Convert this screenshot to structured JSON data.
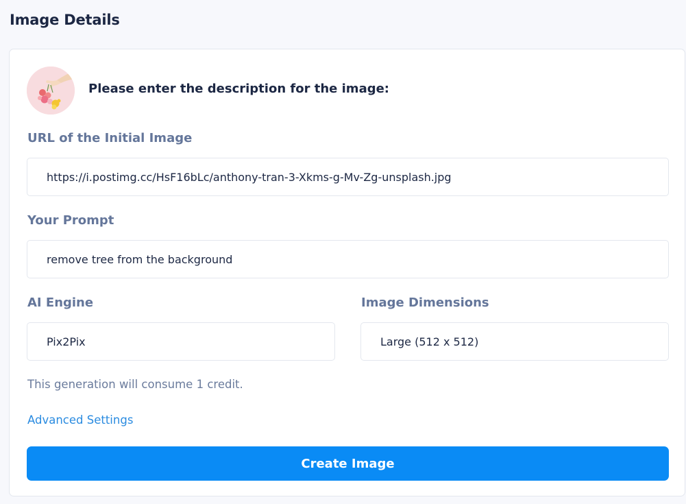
{
  "page": {
    "title": "Image Details"
  },
  "card": {
    "heading": "Please enter the description for the image:",
    "avatar_icon": "hand-with-flowers-icon"
  },
  "fields": {
    "url": {
      "label": "URL of the Initial Image",
      "value": "https://i.postimg.cc/HsF16bLc/anthony-tran-3-Xkms-g-Mv-Zg-unsplash.jpg"
    },
    "prompt": {
      "label": "Your Prompt",
      "value": "remove tree from the background"
    },
    "engine": {
      "label": "AI Engine",
      "value": "Pix2Pix"
    },
    "dimensions": {
      "label": "Image Dimensions",
      "value": "Large (512 x 512)"
    }
  },
  "credit_note": "This generation will consume 1 credit.",
  "advanced_settings_label": "Advanced Settings",
  "create_button_label": "Create Image",
  "colors": {
    "accent": "#0a8bf5",
    "link": "#2a8be0",
    "heading": "#1c2743",
    "label": "#64769a"
  }
}
